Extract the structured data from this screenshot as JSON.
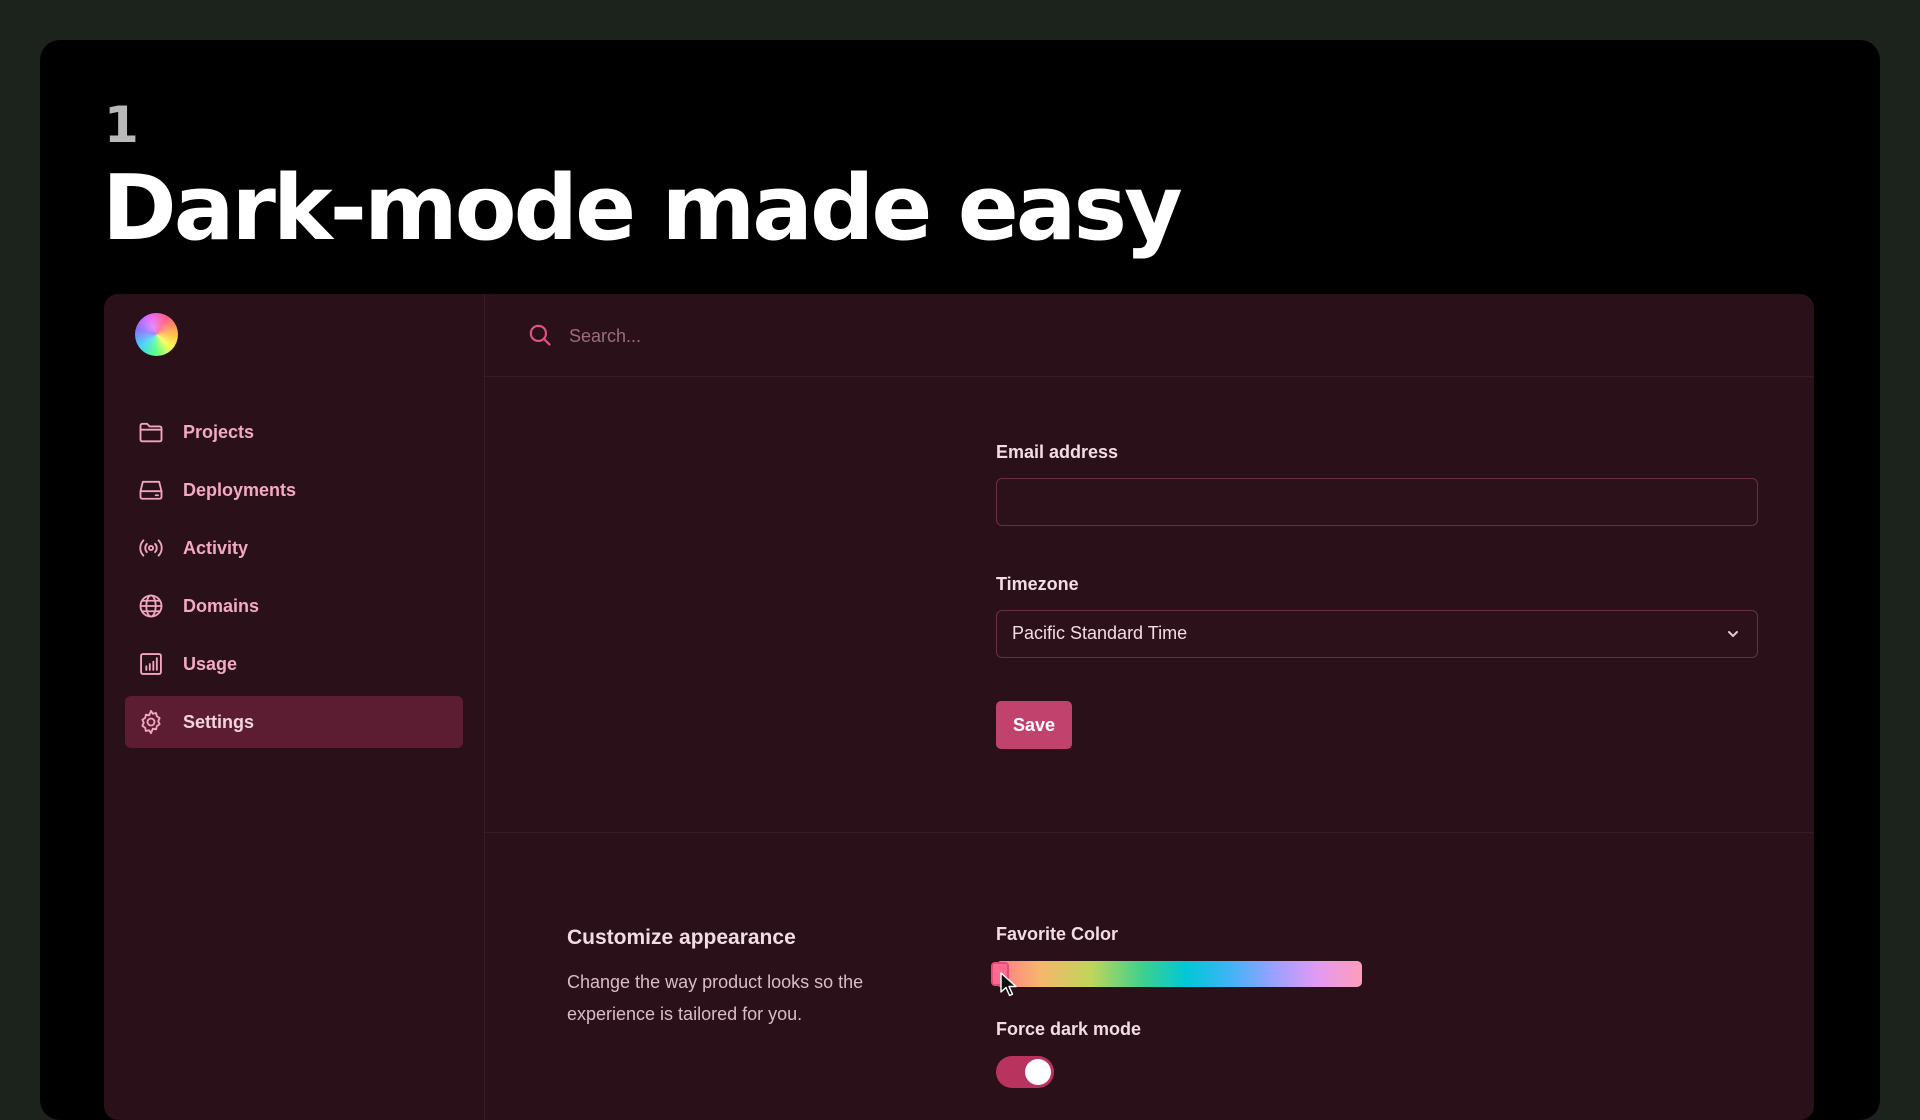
{
  "hero": {
    "number": "1",
    "headline": "Dark-mode made easy"
  },
  "sidebar": {
    "items": [
      {
        "label": "Projects",
        "icon": "folder-icon"
      },
      {
        "label": "Deployments",
        "icon": "server-icon"
      },
      {
        "label": "Activity",
        "icon": "broadcast-icon"
      },
      {
        "label": "Domains",
        "icon": "globe-icon"
      },
      {
        "label": "Usage",
        "icon": "chart-icon"
      },
      {
        "label": "Settings",
        "icon": "gear-icon",
        "active": true
      }
    ]
  },
  "search": {
    "placeholder": "Search..."
  },
  "form": {
    "email_label": "Email address",
    "email_value": "",
    "timezone_label": "Timezone",
    "timezone_value": "Pacific Standard Time",
    "save_label": "Save"
  },
  "appearance": {
    "title": "Customize appearance",
    "description": "Change the way product looks so the experience is tailored for you.",
    "favorite_color_label": "Favorite Color",
    "favorite_color_position": 0.0,
    "force_dark_label": "Force dark mode",
    "force_dark_enabled": true
  },
  "colors": {
    "accent": "#c2426e",
    "active_nav": "#5c1d33",
    "panel_bg": "#2a1019"
  }
}
